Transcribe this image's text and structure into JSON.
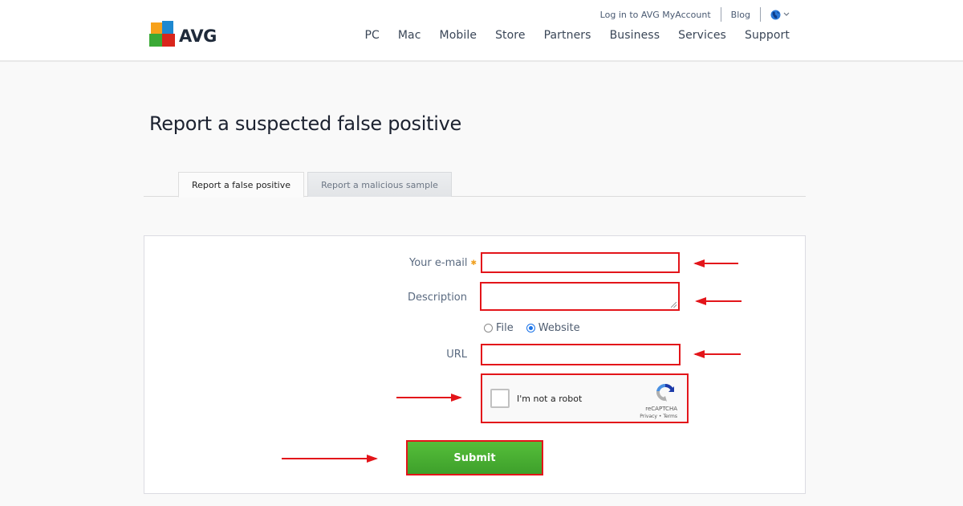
{
  "header": {
    "logo_text": "AVG",
    "top_links": [
      {
        "label": "Log in to AVG MyAccount"
      },
      {
        "label": "Blog"
      }
    ],
    "language_icon": "globe-icon",
    "nav": [
      {
        "label": "PC"
      },
      {
        "label": "Mac"
      },
      {
        "label": "Mobile"
      },
      {
        "label": "Store"
      },
      {
        "label": "Partners"
      },
      {
        "label": "Business"
      },
      {
        "label": "Services"
      },
      {
        "label": "Support"
      }
    ]
  },
  "page": {
    "title": "Report a suspected false positive"
  },
  "tabs": [
    {
      "label": "Report a false positive",
      "active": true
    },
    {
      "label": "Report a malicious sample",
      "active": false
    }
  ],
  "form": {
    "email": {
      "label": "Your e-mail",
      "required_marker": "✱",
      "value": "",
      "placeholder": ""
    },
    "description": {
      "label": "Description",
      "value": "",
      "placeholder": ""
    },
    "type_options": [
      {
        "label": "File",
        "checked": false
      },
      {
        "label": "Website",
        "checked": true
      }
    ],
    "url": {
      "label": "URL",
      "value": "",
      "placeholder": ""
    },
    "captcha": {
      "label": "I'm not a robot",
      "brand": "reCAPTCHA",
      "links": "Privacy - Terms",
      "checked": false
    },
    "submit_label": "Submit"
  },
  "annotations": {
    "highlight_color": "#e3151a",
    "arrows": [
      "email-field",
      "description-field",
      "url-field",
      "captcha",
      "submit-button"
    ]
  },
  "colors": {
    "submit_green": "#4bb033",
    "radio_blue": "#1a73e8",
    "required_orange": "#f0a020"
  }
}
